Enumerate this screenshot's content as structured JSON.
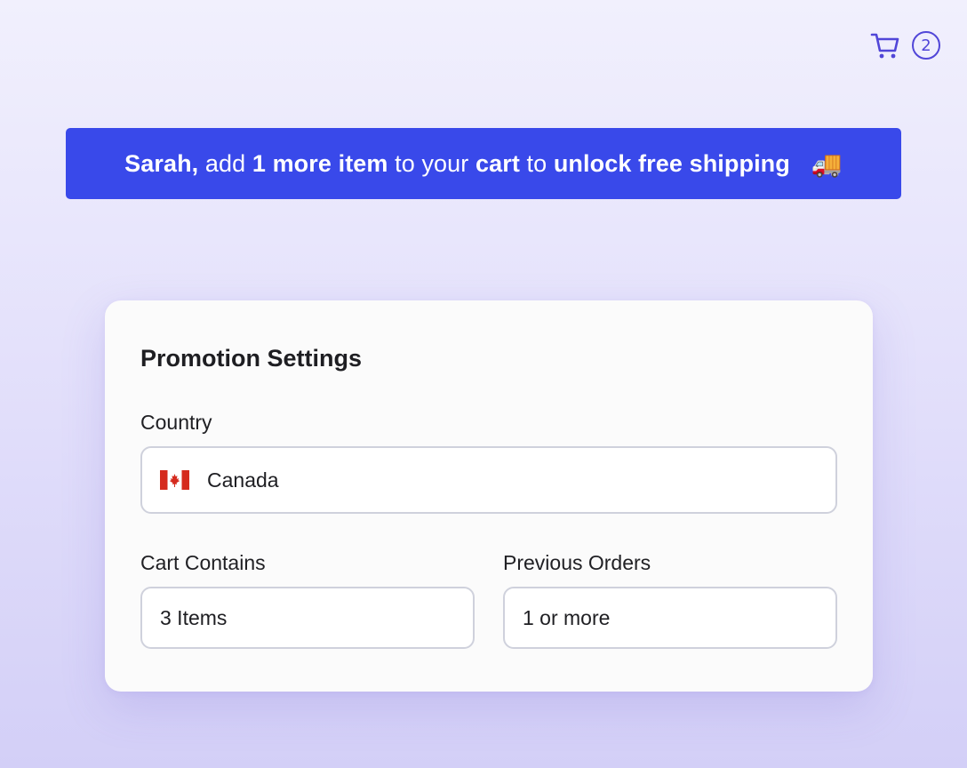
{
  "header": {
    "cart_icon": "shopping-cart-icon",
    "cart_count": "2"
  },
  "banner": {
    "name": "Sarah,",
    "text_1": " add ",
    "bold_1": "1 more item",
    "text_2": " to your ",
    "bold_2": "cart",
    "text_3": " to ",
    "bold_3": "unlock free shipping",
    "emoji": "🚚",
    "background_color": "#3949ea"
  },
  "card": {
    "title": "Promotion Settings",
    "country": {
      "label": "Country",
      "flag_icon": "canada-flag-icon",
      "value": "Canada"
    },
    "cart_contains": {
      "label": "Cart Contains",
      "value": "3 Items"
    },
    "previous_orders": {
      "label": "Previous Orders",
      "value": "1 or more"
    }
  },
  "colors": {
    "accent": "#5146d8",
    "banner": "#3949ea"
  }
}
